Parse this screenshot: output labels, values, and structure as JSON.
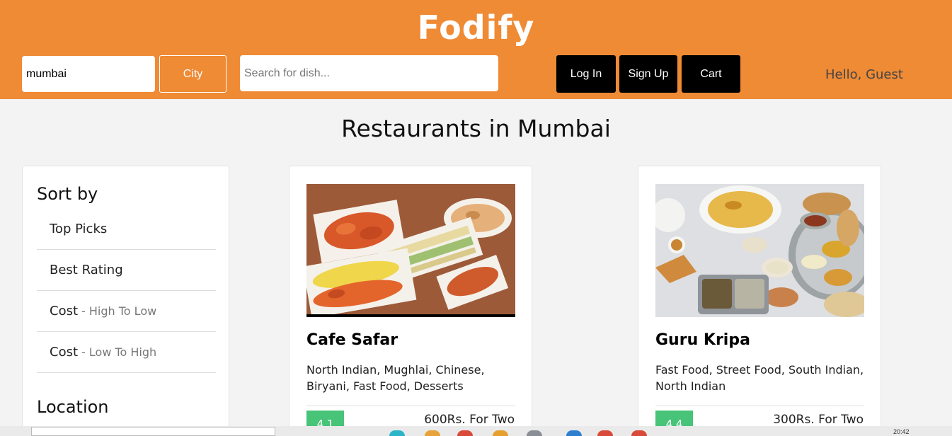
{
  "header": {
    "logo": "Fodify",
    "city_input_value": "mumbai",
    "city_button": "City",
    "dish_search_placeholder": "Search for dish...",
    "login": "Log In",
    "signup": "Sign Up",
    "cart": "Cart",
    "greeting": "Hello, Guest"
  },
  "page": {
    "title": "Restaurants in Mumbai"
  },
  "sidebar": {
    "sort_title": "Sort by",
    "sort_options": [
      {
        "label": "Top Picks",
        "sub": ""
      },
      {
        "label": "Best Rating",
        "sub": ""
      },
      {
        "label": "Cost",
        "sub": "- High To Low"
      },
      {
        "label": "Cost",
        "sub": "- Low To High"
      }
    ],
    "location_title": "Location"
  },
  "restaurants": [
    {
      "name": "Cafe Safar",
      "cuisines": "North Indian, Mughlai, Chinese, Biryani, Fast Food, Desserts",
      "rating": "4.1",
      "cost": "600Rs. For Two"
    },
    {
      "name": "Guru Kripa",
      "cuisines": "Fast Food, Street Food, South Indian, North Indian",
      "rating": "4.4",
      "cost": "300Rs. For Two"
    }
  ],
  "taskbar": {
    "clock": "20:42"
  },
  "colors": {
    "header": "#ef8a35",
    "rating": "#48c479",
    "button": "#000000"
  }
}
